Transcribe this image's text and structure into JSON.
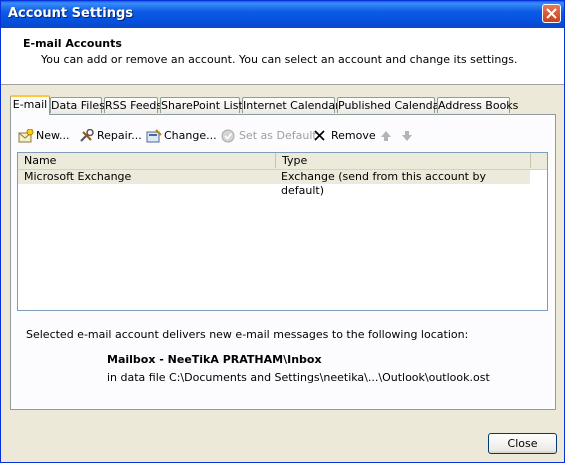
{
  "window": {
    "title": "Account Settings"
  },
  "header": {
    "title": "E-mail Accounts",
    "description": "You can add or remove an account. You can select an account and change its settings."
  },
  "tabs": [
    {
      "label": "E-mail"
    },
    {
      "label": "Data Files"
    },
    {
      "label": "RSS Feeds"
    },
    {
      "label": "SharePoint Lists"
    },
    {
      "label": "Internet Calendars"
    },
    {
      "label": "Published Calendars"
    },
    {
      "label": "Address Books"
    }
  ],
  "toolbar": {
    "new": "New...",
    "repair": "Repair...",
    "change": "Change...",
    "set_default": "Set as Default",
    "remove": "Remove"
  },
  "list": {
    "columns": [
      "Name",
      "Type"
    ],
    "rows": [
      {
        "name": "Microsoft Exchange",
        "type": "Exchange (send from this account by default)"
      }
    ]
  },
  "location": {
    "info": "Selected e-mail account delivers new e-mail messages to the following location:",
    "mailbox": "Mailbox - NeeTikA PRATHAM\\Inbox",
    "data_file": "in data file C:\\Documents and Settings\\neetika\\...\\Outlook\\outlook.ost"
  },
  "buttons": {
    "close": "Close"
  }
}
